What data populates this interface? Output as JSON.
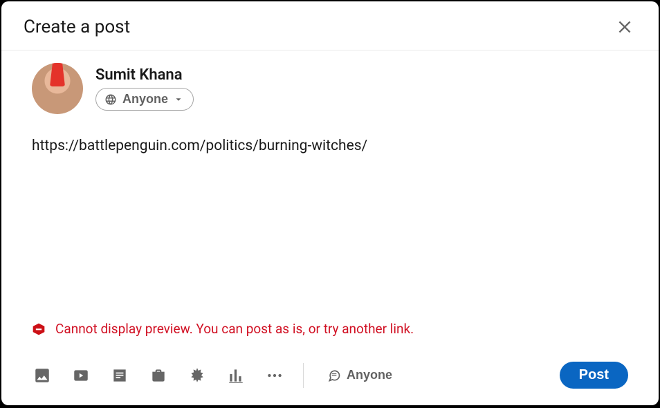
{
  "modal": {
    "title": "Create a post"
  },
  "author": {
    "name": "Sumit Khana",
    "audience_label": "Anyone"
  },
  "post": {
    "text": "https://battlepenguin.com/politics/burning-witches/"
  },
  "error": {
    "message": "Cannot display preview. You can post as is, or try another link."
  },
  "footer": {
    "comment_audience_label": "Anyone",
    "post_button_label": "Post"
  }
}
